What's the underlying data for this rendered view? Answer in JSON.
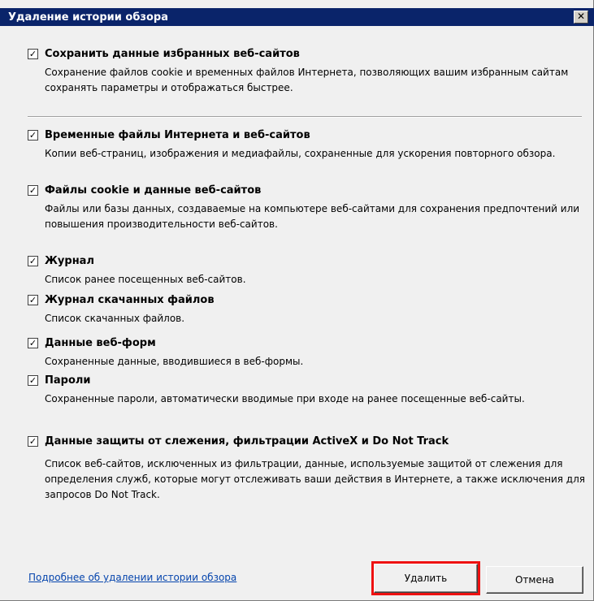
{
  "window": {
    "title": "Удаление истории обзора",
    "close_label": "✕"
  },
  "items": [
    {
      "label": "Сохранить данные избранных веб-сайтов",
      "desc": "Сохранение файлов cookie и временных файлов Интернета, позволяющих вашим избранным сайтам сохранять параметры и отображаться быстрее.",
      "checked": true
    },
    {
      "label": "Временные файлы Интернета и веб-сайтов",
      "desc": "Копии веб-страниц, изображения и медиафайлы, сохраненные для ускорения повторного обзора.",
      "checked": true
    },
    {
      "label": "Файлы cookie и данные веб-сайтов",
      "desc": "Файлы или базы данных, создаваемые на компьютере веб-сайтами для сохранения предпочтений или повышения производительности веб-сайтов.",
      "checked": true
    },
    {
      "label": "Журнал",
      "desc": "Список ранее посещенных веб-сайтов.",
      "checked": true
    },
    {
      "label": "Журнал скачанных файлов",
      "desc": "Список скачанных файлов.",
      "checked": true
    },
    {
      "label": "Данные веб-форм",
      "desc": "Сохраненные данные, вводившиеся в веб-формы.",
      "checked": true
    },
    {
      "label": "Пароли",
      "desc": "Сохраненные пароли, автоматически вводимые при входе на ранее посещенные веб-сайты.",
      "checked": true
    },
    {
      "label": "Данные защиты от слежения, фильтрации ActiveX и Do Not Track",
      "desc": "Список веб-сайтов, исключенных из фильтрации, данные, используемые защитой от слежения для определения служб, которые могут отслеживать ваши действия в Интернете, а также исключения для запросов Do Not Track.",
      "checked": true
    }
  ],
  "footer": {
    "link": "Подробнее об удалении истории обзора",
    "delete_label": "Удалить",
    "cancel_label": "Отмена"
  },
  "colors": {
    "titlebar": "#0a246a",
    "highlight": "#e11111",
    "link": "#0645ad"
  }
}
